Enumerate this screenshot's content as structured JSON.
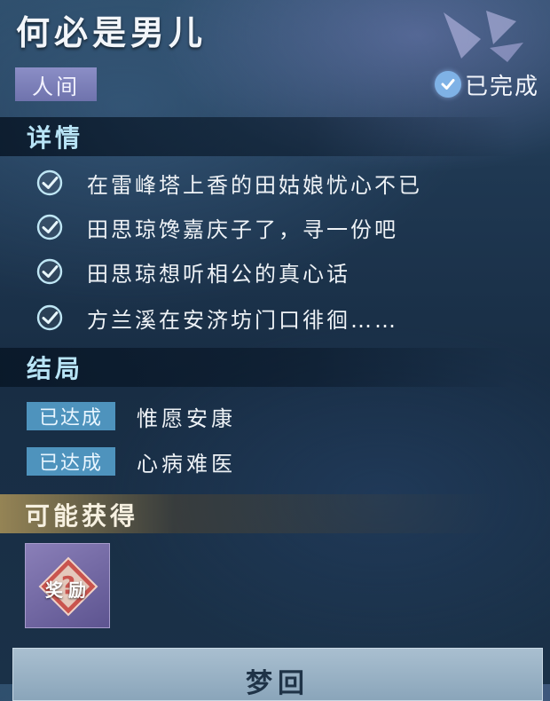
{
  "header": {
    "title": "何必是男儿",
    "category": "人间",
    "status": "已完成"
  },
  "details": {
    "heading": "详情",
    "items": [
      "在雷峰塔上香的田姑娘忧心不已",
      "田思琼馋嘉庆子了，寻一份吧",
      "田思琼想听相公的真心话",
      "方兰溪在安济坊门口徘徊……"
    ]
  },
  "endings": {
    "heading": "结局",
    "items": [
      {
        "badge": "已达成",
        "text": "惟愿安康"
      },
      {
        "badge": "已达成",
        "text": "心病难医"
      }
    ]
  },
  "rewards": {
    "heading": "可能获得",
    "item_label": "奖励"
  },
  "footer": {
    "button_label": "梦回"
  },
  "colors": {
    "section_title": "#b8e4f6",
    "category_badge": "#7d80bb",
    "achieved_badge": "#4e93bd",
    "check": "#bfe6f4"
  },
  "icons": {
    "status": "check-circle-icon",
    "detail": "check-circle-icon",
    "reward": "mystery-reward-icon",
    "emblem": "butterfly-emblem-icon"
  }
}
